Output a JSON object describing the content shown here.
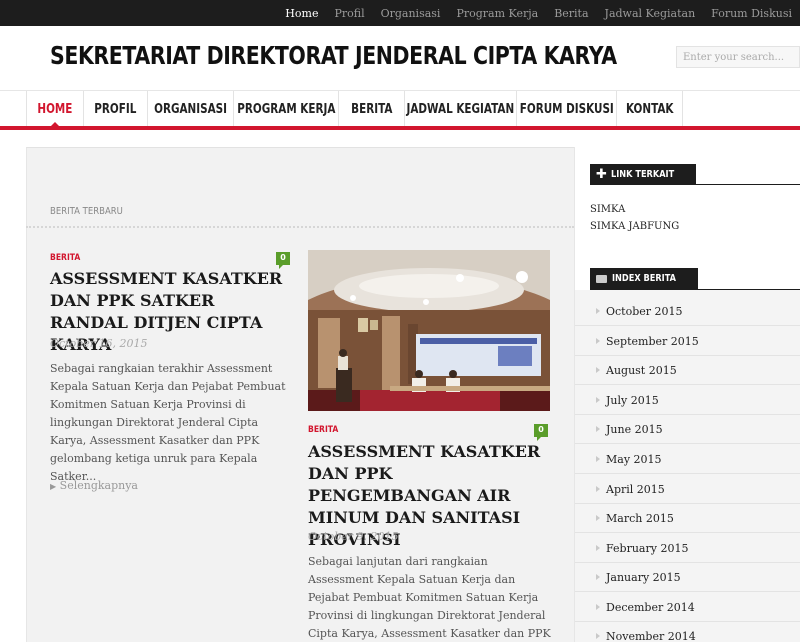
{
  "topnav": [
    "Home",
    "Profil",
    "Organisasi",
    "Program Kerja",
    "Berita",
    "Jadwal Kegiatan",
    "Forum Diskusi"
  ],
  "site": {
    "title": "SEKRETARIAT DIREKTORAT JENDERAL CIPTA KARYA",
    "search_placeholder": "Enter your search..."
  },
  "mainnav": [
    "HOME",
    "PROFIL",
    "ORGANISASI",
    "PROGRAM KERJA",
    "BERITA",
    "JADWAL KEGIATAN",
    "FORUM DISKUSI",
    "KONTAK"
  ],
  "section_label": "BERITA TERBARU",
  "posts": [
    {
      "category": "BERITA",
      "comments": "0",
      "title": "ASSESSMENT KASATKER DAN PPK SATKER RANDAL DITJEN CIPTA KARYA",
      "date": "October 16, 2015",
      "excerpt": "Sebagai rangkaian  terakhir Assessment Kepala Satuan Kerja dan Pejabat Pembuat Komitmen Satuan Kerja Provinsi di lingkungan Direktorat Jenderal Cipta Karya, Assessment Kasatker dan PPK gelombang ketiga unruk para Kepala Satker...",
      "readmore": "Selengkapnya"
    },
    {
      "category": "BERITA",
      "comments": "0",
      "title": "ASSESSMENT KASATKER DAN PPK PENGEMBANGAN AIR MINUM DAN SANITASI PROVINSI",
      "date": "October 9, 2015",
      "excerpt": "Sebagai lanjutan dari rangkaian Assessment Kepala Satuan Kerja dan Pejabat Pembuat Komitmen Satuan Kerja Provinsi di lingkungan Direktorat Jenderal Cipta Karya, Assessment Kasatker dan PPK gelombang"
    }
  ],
  "sidebar": {
    "link_title": "LINK TERKAIT",
    "links": [
      "SIMKA",
      "SIMKA JABFUNG"
    ],
    "archive_title": "INDEX BERITA",
    "archives": [
      "October 2015",
      "September 2015",
      "August 2015",
      "July 2015",
      "June 2015",
      "May 2015",
      "April 2015",
      "March 2015",
      "February 2015",
      "January 2015",
      "December 2014",
      "November 2014"
    ]
  },
  "colors": {
    "accent": "#d2162e",
    "topbar": "#1d1d1d",
    "badge": "#5a9d2a"
  }
}
